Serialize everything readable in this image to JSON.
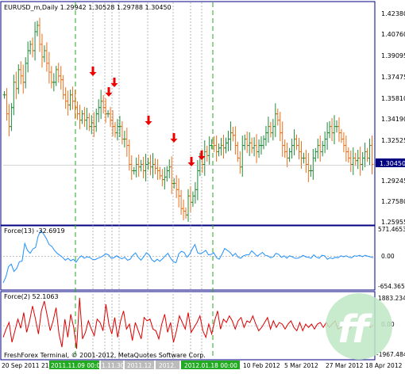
{
  "main_panel": {
    "title": "EURUSD_m,Daily  1.29942 1.30528 1.29788 1.30450",
    "price_labels": [
      "1.42380",
      "1.40760",
      "1.39095",
      "1.37475",
      "1.35810",
      "1.34190",
      "1.32525",
      "1.30450",
      "1.29245",
      "1.27580",
      "1.25955"
    ],
    "current_price": "1.30450"
  },
  "force13_panel": {
    "title": "Force(13) -32.6919",
    "scale_labels": [
      "571.4653",
      "0.00",
      "-654.365"
    ]
  },
  "force2_panel": {
    "title": "Force(2) 52.1063",
    "scale_labels": [
      "1883.234",
      "0.00",
      "-1967.484"
    ]
  },
  "copyright": "FreshForex Terminal, © 2001-2012, MetaQuotes Software Corp.",
  "time_axis": {
    "labels": [
      "20 Sep 2011",
      "21",
      "2011.11.09 00:00",
      "1.11.30",
      "2011.12.",
      "2012.",
      "2012.01.18 00:00",
      "10 Feb 2012",
      "5 Mar 2012",
      "27 Mar 2012",
      "18 Apr 2012"
    ]
  },
  "colors": {
    "bull_bar": "#1f8a3a",
    "bear_bar": "#e8701a",
    "force13_line": "#1e90ff",
    "force2_line": "#dd0000",
    "arrow": "#ee0000",
    "green_dashed": "#22aa22",
    "frame": "#000080",
    "highlight_label_bg": "#22aa22"
  },
  "chart_data": [
    {
      "type": "ohlc",
      "title": "EURUSD_m,Daily",
      "timeframe": "Daily",
      "last_bar": {
        "open": 1.29942,
        "high": 1.30528,
        "low": 1.29788,
        "close": 1.3045
      },
      "ylim": [
        1.25955,
        1.4238
      ],
      "y_ticks": [
        1.4238,
        1.4076,
        1.39095,
        1.37475,
        1.3581,
        1.3419,
        1.32525,
        1.29245,
        1.2758,
        1.25955
      ],
      "close_series": [
        1.36,
        1.345,
        1.335,
        1.35,
        1.37,
        1.365,
        1.38,
        1.375,
        1.37,
        1.385,
        1.395,
        1.4,
        1.395,
        1.41,
        1.415,
        1.4,
        1.39,
        1.395,
        1.385,
        1.378,
        1.37,
        1.37,
        1.38,
        1.375,
        1.372,
        1.36,
        1.355,
        1.352,
        1.36,
        1.355,
        1.35,
        1.345,
        1.34,
        1.345,
        1.34,
        1.342,
        1.335,
        1.338,
        1.335,
        1.345,
        1.35,
        1.355,
        1.35,
        1.345,
        1.345,
        1.34,
        1.335,
        1.33,
        1.335,
        1.335,
        1.325,
        1.325,
        1.32,
        1.305,
        1.3,
        1.3,
        1.305,
        1.303,
        1.305,
        1.3,
        1.305,
        1.306,
        1.303,
        1.305,
        1.302,
        1.3,
        1.296,
        1.293,
        1.295,
        1.3,
        1.303,
        1.29,
        1.29,
        1.285,
        1.28,
        1.27,
        1.268,
        1.265,
        1.28,
        1.275,
        1.28,
        1.285,
        1.3,
        1.31,
        1.305,
        1.315,
        1.312,
        1.32,
        1.322,
        1.32,
        1.315,
        1.318,
        1.32,
        1.318,
        1.322,
        1.325,
        1.33,
        1.328,
        1.32,
        1.31,
        1.303,
        1.32,
        1.325,
        1.32,
        1.322,
        1.318,
        1.32,
        1.315,
        1.32,
        1.32,
        1.325,
        1.33,
        1.335,
        1.33,
        1.335,
        1.345,
        1.34,
        1.33,
        1.32,
        1.315,
        1.31,
        1.315,
        1.32,
        1.325,
        1.32,
        1.315,
        1.31,
        1.31,
        1.305,
        1.3,
        1.3,
        1.31,
        1.315,
        1.32,
        1.315,
        1.32,
        1.325,
        1.33,
        1.335,
        1.33,
        1.335,
        1.335,
        1.33,
        1.325,
        1.32,
        1.315,
        1.31,
        1.305,
        1.31,
        1.308,
        1.31,
        1.305,
        1.31,
        1.315,
        1.31,
        1.32,
        1.305
      ],
      "arrow_down_markers": 6,
      "green_dashed_vlines": 2,
      "gray_dotted_vlines": 8
    },
    {
      "type": "line",
      "title": "Force(13)",
      "current_value": -32.6919,
      "ylim": [
        -654.365,
        571.4653
      ],
      "zero_line": 0.0,
      "values": [
        -540,
        -420,
        -210,
        -160,
        -310,
        -250,
        -110,
        -100,
        260,
        120,
        60,
        150,
        180,
        420,
        520,
        450,
        360,
        240,
        200,
        120,
        60,
        20,
        -20,
        -80,
        -40,
        -90,
        -60,
        -120,
        -40,
        10,
        -40,
        -10,
        -20,
        -60,
        -70,
        -40,
        -20,
        10,
        50,
        30,
        -40,
        -30,
        10,
        -30,
        -50,
        -20,
        -80,
        -60,
        20,
        70,
        -20,
        -80,
        -10,
        70,
        30,
        -70,
        -110,
        -60,
        -100,
        -50,
        10,
        60,
        -40,
        -110,
        -130,
        50,
        100,
        80,
        -20,
        40,
        150,
        240,
        70,
        50,
        80,
        120,
        30,
        40,
        70,
        -30,
        -60,
        40,
        160,
        120,
        80,
        10,
        60,
        -20,
        -40,
        10,
        30,
        30,
        110,
        60,
        0,
        40,
        80,
        20,
        10,
        -30,
        -10,
        60,
        40,
        -20,
        10,
        -40,
        10,
        -10,
        -40,
        -40,
        -20,
        20,
        -10,
        -20,
        -40,
        30,
        -20,
        -40,
        20,
        10,
        -60,
        -30,
        -50,
        -20,
        -30,
        10,
        -10,
        10,
        -20,
        -30,
        10,
        0,
        20,
        -10,
        20,
        0,
        -10,
        -30
      ],
      "color": "#1e90ff"
    },
    {
      "type": "line",
      "title": "Force(2)",
      "current_value": 52.1063,
      "ylim": [
        -1967.484,
        1883.234
      ],
      "zero_line": 0.0,
      "values": [
        -700,
        -200,
        200,
        -1000,
        -300,
        400,
        -150,
        800,
        -400,
        300,
        1200,
        400,
        -500,
        900,
        1500,
        600,
        -300,
        300,
        1100,
        -500,
        -1300,
        400,
        -700,
        700,
        -100,
        -1400,
        1700,
        -800,
        -400,
        300,
        -200,
        -600,
        400,
        200,
        -300,
        1300,
        100,
        -500,
        500,
        -700,
        300,
        900,
        -200,
        100,
        -900,
        200,
        -300,
        -800,
        500,
        300,
        400,
        -200,
        -300,
        -800,
        100,
        700,
        -400,
        200,
        -1000,
        -300,
        600,
        200,
        -200,
        800,
        -400,
        -100,
        200,
        600,
        -300,
        -700,
        100,
        -500,
        300,
        900,
        -200,
        400,
        200,
        600,
        300,
        -200,
        300,
        500,
        -100,
        300,
        200,
        600,
        100,
        -300,
        -100,
        200,
        500,
        -200,
        300,
        -100,
        200,
        100,
        -200,
        100,
        300,
        -100,
        -300,
        200,
        -300,
        100,
        -100,
        100,
        -200,
        100,
        200,
        -100,
        200,
        -100,
        100,
        300,
        -200,
        -100,
        200,
        -100,
        -200,
        100,
        200,
        100,
        -300,
        100,
        200,
        -100,
        50
      ]
    }
  ]
}
